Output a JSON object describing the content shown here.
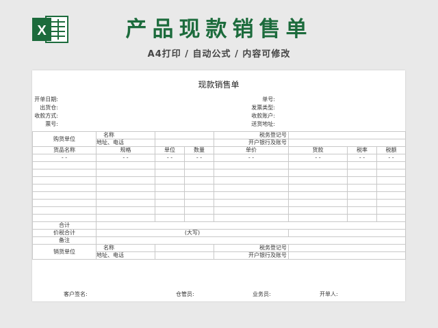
{
  "banner": {
    "title": "产品现款销售单",
    "subtitle": "A4打印 / 自动公式 / 内容可修改",
    "logo_icon": "excel-icon",
    "logo_letter": "X",
    "brand_color": "#1c6b3c"
  },
  "sheet": {
    "title": "现款销售单",
    "info_left": [
      "开单日期:",
      "出货仓:",
      "收款方式:",
      "票号:"
    ],
    "info_right": [
      "单号:",
      "发票类型:",
      "收款账户:",
      "送货地址:"
    ],
    "buyer": {
      "unit_label": "购货单位",
      "name_label": "名称",
      "address_label": "地址、电话",
      "tax_label": "税务登记号",
      "bank_label": "开户银行及账号"
    },
    "columns": [
      "货品名称",
      "规格",
      "单位",
      "数量",
      "单价",
      "货款",
      "税率",
      "税额"
    ],
    "placeholder_dash": "- -",
    "total_label": "合计",
    "tax_total_label": "价税合计",
    "daxie_label": "(大写)",
    "remark_label": "备注",
    "seller": {
      "unit_label": "销货单位",
      "name_label": "名称",
      "address_label": "地址、电话",
      "tax_label": "税务登记号",
      "bank_label": "开户银行及账号"
    },
    "signatures": [
      "客户签名:",
      "仓管员:",
      "业务员:",
      "开单人:"
    ]
  }
}
